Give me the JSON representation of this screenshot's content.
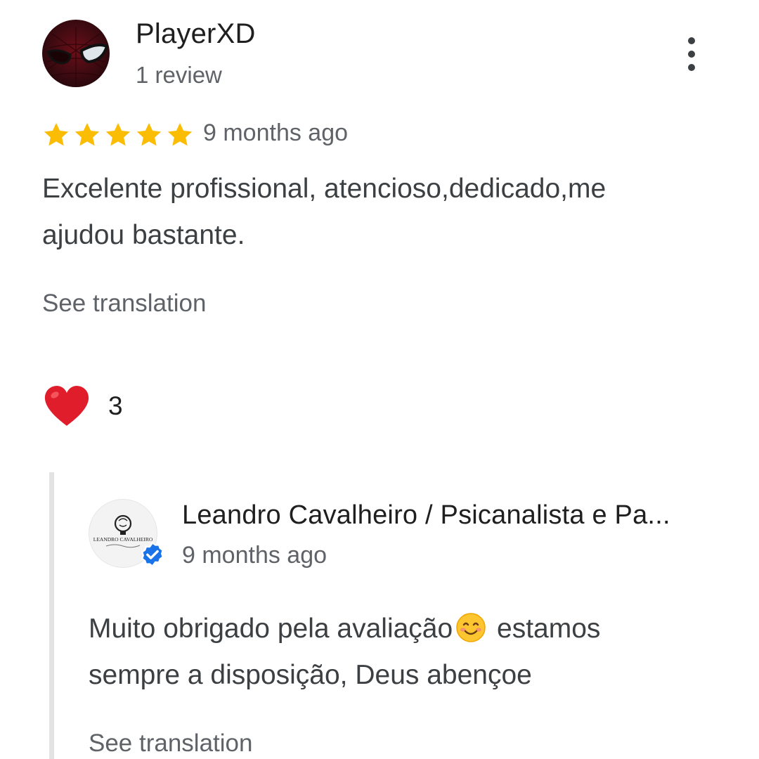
{
  "review": {
    "reviewer_name": "PlayerXD",
    "review_count": "1 review",
    "rating": 5,
    "date": "9 months ago",
    "text_line1": "Excelente profissional, atencioso,dedicado,me",
    "text_line2": "ajudou bastante.",
    "see_translation": "See translation",
    "reaction_count": "3"
  },
  "owner_reply": {
    "name": "Leandro Cavalheiro / Psicanalista e Pa...",
    "date": "9 months ago",
    "text_part1": "Muito obrigado pela avaliação",
    "text_part2": " estamos",
    "text_line2": "sempre a disposição, Deus abençoe",
    "see_translation": "See translation",
    "logo_text": "LEANDRO CAVALHEIRO"
  },
  "colors": {
    "star": "#fbbc04",
    "heart": "#e01e2b",
    "verified_badge": "#1a73e8",
    "secondary_text": "#5f6368"
  }
}
